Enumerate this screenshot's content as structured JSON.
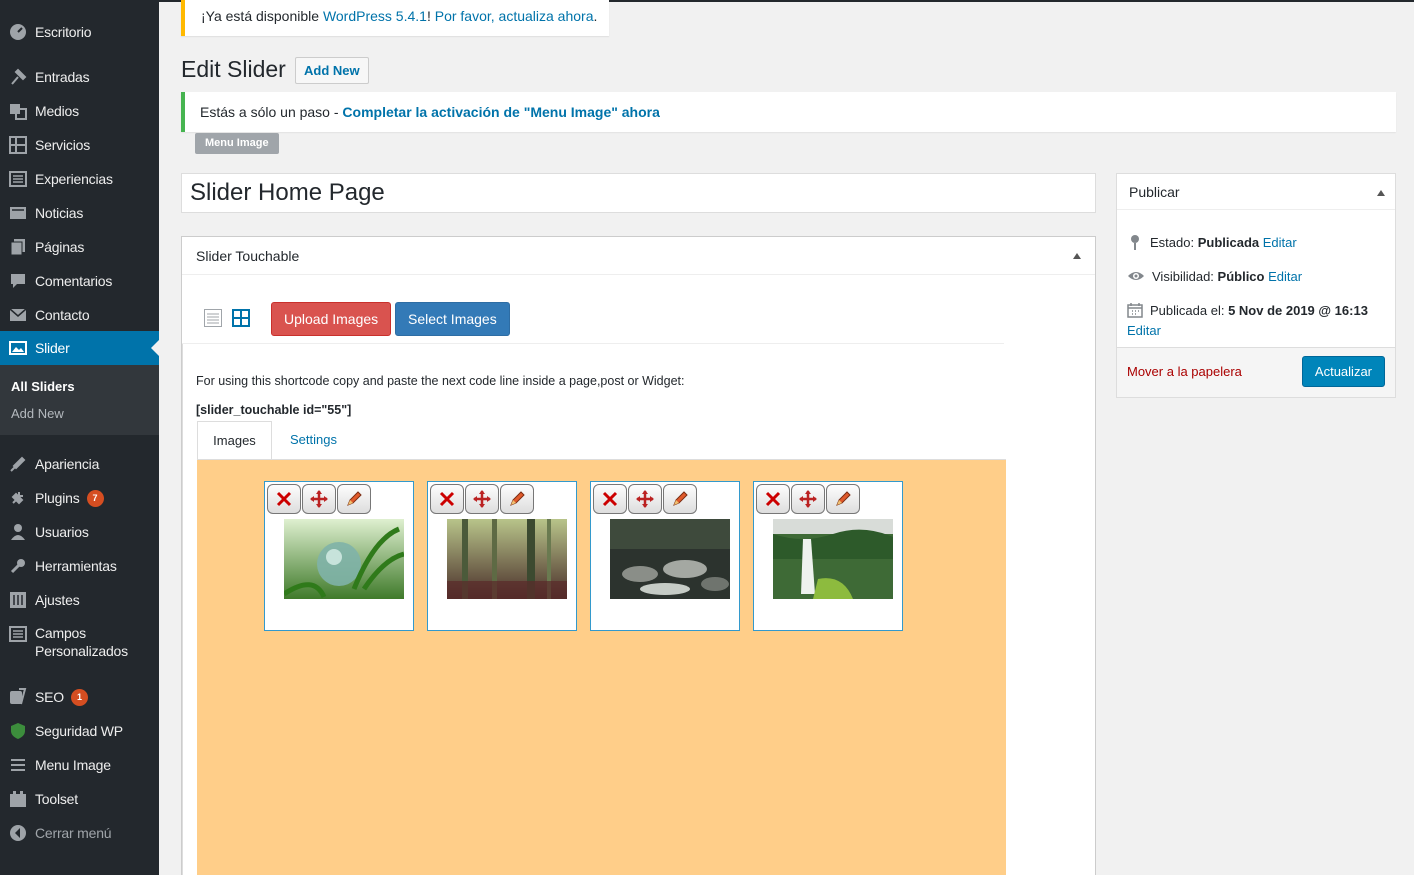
{
  "sidebar": {
    "items": [
      {
        "label": "Escritorio",
        "icon": "dashboard-icon"
      },
      {
        "label": "Entradas",
        "icon": "pin-icon"
      },
      {
        "label": "Medios",
        "icon": "media-icon"
      },
      {
        "label": "Servicios",
        "icon": "layout-icon"
      },
      {
        "label": "Experiencias",
        "icon": "list-icon"
      },
      {
        "label": "Noticias",
        "icon": "news-icon"
      },
      {
        "label": "Páginas",
        "icon": "pages-icon"
      },
      {
        "label": "Comentarios",
        "icon": "comment-icon"
      },
      {
        "label": "Contacto",
        "icon": "mail-icon"
      },
      {
        "label": "Slider",
        "icon": "slider-icon"
      },
      {
        "label": "Apariencia",
        "icon": "brush-icon"
      },
      {
        "label": "Plugins",
        "icon": "plug-icon",
        "badge": "7"
      },
      {
        "label": "Usuarios",
        "icon": "user-icon"
      },
      {
        "label": "Herramientas",
        "icon": "wrench-icon"
      },
      {
        "label": "Ajustes",
        "icon": "settings-icon"
      },
      {
        "label": "Campos",
        "label2": "Personalizados",
        "icon": "fields-icon"
      },
      {
        "label": "SEO",
        "icon": "seo-icon",
        "badge": "1"
      },
      {
        "label": "Seguridad WP",
        "icon": "shield-icon"
      },
      {
        "label": "Menu Image",
        "icon": "menu-icon"
      },
      {
        "label": "Toolset",
        "icon": "toolset-icon"
      },
      {
        "label": "Cerrar menú",
        "icon": "collapse-icon"
      }
    ],
    "submenu": [
      "All Sliders",
      "Add New"
    ]
  },
  "notices": {
    "update_prefix": "¡Ya está disponible ",
    "update_link1": "WordPress 5.4.1",
    "update_mid": "! ",
    "update_link2": "Por favor, actualiza ahora",
    "update_suffix": ".",
    "activation_prefix": "Estás a sólo un paso - ",
    "activation_link": "Completar la activación de \"Menu Image\" ahora",
    "menu_image_tag": "Menu Image"
  },
  "header": {
    "title": "Edit Slider",
    "add_new": "Add New"
  },
  "post": {
    "title": "Slider Home Page"
  },
  "slider_box": {
    "heading": "Slider Touchable",
    "upload_label": "Upload Images",
    "select_label": "Select Images",
    "instructions": "For using this shortcode copy and paste the next code line inside a page,post or Widget:",
    "shortcode": "[slider_touchable id=\"55\"]",
    "tabs": [
      "Images",
      "Settings"
    ],
    "gallery_bg": "#ffce89",
    "images": [
      {
        "name": "globe-fern-photo"
      },
      {
        "name": "misty-forest-photo"
      },
      {
        "name": "forest-stream-photo"
      },
      {
        "name": "waterfall-photo"
      }
    ]
  },
  "publish": {
    "heading": "Publicar",
    "status_label": "Estado: ",
    "status_value": "Publicada",
    "visibility_label": "Visibilidad: ",
    "visibility_value": "Público",
    "published_label": "Publicada el: ",
    "published_value": "5 Nov de 2019 @ 16:13",
    "edit": "Editar",
    "trash": "Mover a la papelera",
    "update": "Actualizar"
  },
  "colors": {
    "sidebar_bg": "#23282d",
    "accent": "#0073aa",
    "upload_btn": "#d9534f",
    "select_btn": "#337ab7",
    "badge": "#d54e21"
  }
}
